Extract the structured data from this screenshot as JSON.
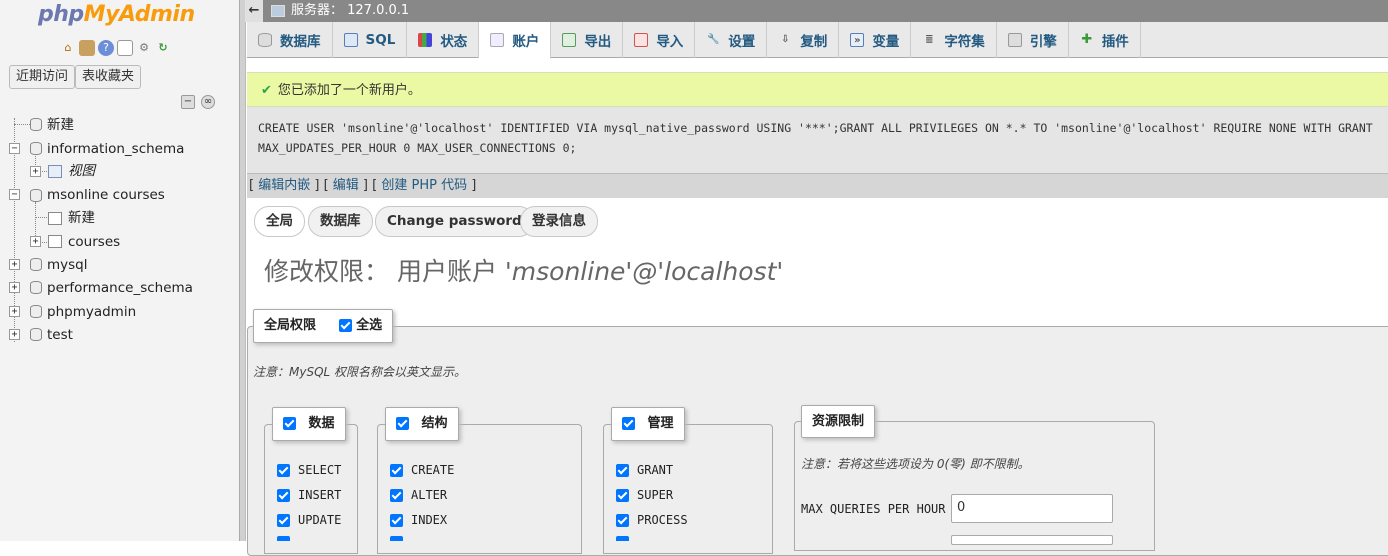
{
  "logo": {
    "part1": "php",
    "part2": "MyAdmin"
  },
  "sidebar": {
    "recent": "近期访问",
    "favorites": "表收藏夹",
    "tree": [
      {
        "label": "新建"
      },
      {
        "label": "information_schema"
      },
      {
        "label": "视图"
      },
      {
        "label": "msonline courses"
      },
      {
        "label": "新建"
      },
      {
        "label": "courses"
      },
      {
        "label": "mysql"
      },
      {
        "label": "performance_schema"
      },
      {
        "label": "phpmyadmin"
      },
      {
        "label": "test"
      }
    ]
  },
  "topbar": {
    "server": "服务器： 127.0.0.1"
  },
  "tabs": [
    {
      "label": "数据库",
      "icon": "database-icon"
    },
    {
      "label": "SQL",
      "icon": "sql-icon"
    },
    {
      "label": "状态",
      "icon": "status-icon"
    },
    {
      "label": "账户",
      "icon": "accounts-icon"
    },
    {
      "label": "导出",
      "icon": "export-icon"
    },
    {
      "label": "导入",
      "icon": "import-icon"
    },
    {
      "label": "设置",
      "icon": "settings-icon"
    },
    {
      "label": "复制",
      "icon": "replication-icon"
    },
    {
      "label": "变量",
      "icon": "variables-icon"
    },
    {
      "label": "字符集",
      "icon": "charset-icon"
    },
    {
      "label": "引擎",
      "icon": "engines-icon"
    },
    {
      "label": "插件",
      "icon": "plugins-icon"
    }
  ],
  "message": {
    "text": "您已添加了一个新用户。"
  },
  "sql": {
    "line1": "CREATE USER 'msonline'@'localhost' IDENTIFIED VIA mysql_native_password USING '***';GRANT ALL PRIVILEGES ON *.* TO 'msonline'@'localhost' REQUIRE NONE WITH GRANT",
    "line2": "MAX_UPDATES_PER_HOUR 0 MAX_USER_CONNECTIONS 0;"
  },
  "links": {
    "inline": "编辑内嵌",
    "edit": "编辑",
    "php": "创建 PHP 代码"
  },
  "subtabs": [
    "全局",
    "数据库",
    "Change password",
    "登录信息"
  ],
  "page_title": {
    "prefix": "修改权限：  用户账户 ",
    "account": "'msonline'@'localhost'"
  },
  "global": {
    "legend": "全局权限",
    "select_all": "全选",
    "note": "注意：MySQL 权限名称会以英文显示。"
  },
  "groups": {
    "data": {
      "legend": "数据",
      "items": [
        "SELECT",
        "INSERT",
        "UPDATE"
      ]
    },
    "structure": {
      "legend": "结构",
      "items": [
        "CREATE",
        "ALTER",
        "INDEX"
      ]
    },
    "admin": {
      "legend": "管理",
      "items": [
        "GRANT",
        "SUPER",
        "PROCESS"
      ]
    }
  },
  "resources": {
    "legend": "资源限制",
    "note": "注意：若将这些选项设为 0(零) 即不限制。",
    "max_queries_label": "MAX QUERIES PER HOUR",
    "max_queries_value": "0"
  }
}
